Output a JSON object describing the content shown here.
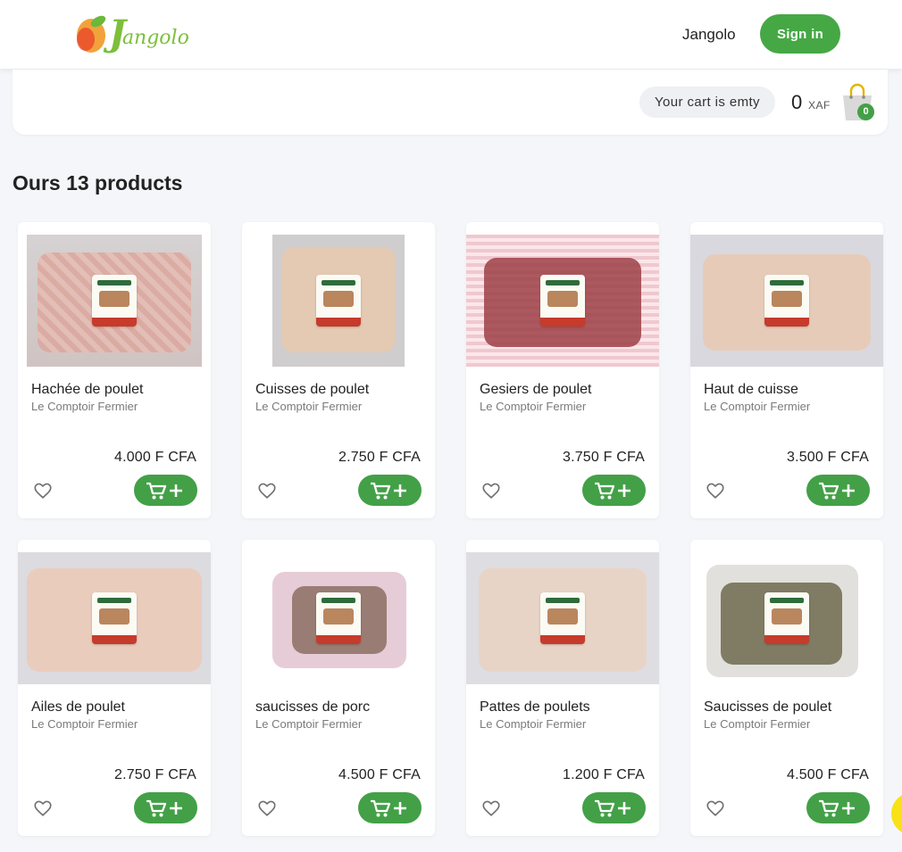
{
  "header": {
    "logo_text_initial": "J",
    "logo_text_rest": "angolo",
    "nav_link": "Jangolo",
    "signin_label": "Sign in"
  },
  "cart": {
    "status": "Your cart is emty",
    "total": "0",
    "currency": "XAF",
    "count": "0"
  },
  "section_title": "Ours 13 products",
  "colors": {
    "accent_green": "#43a047",
    "brand_green": "#7cbf3a",
    "logo_orange": "#f2a23a"
  },
  "products": [
    {
      "name": "Hachée de poulet",
      "vendor": "Le Comptoir Fermier",
      "price": "4.000 F CFA"
    },
    {
      "name": "Cuisses de poulet",
      "vendor": "Le Comptoir Fermier",
      "price": "2.750 F CFA"
    },
    {
      "name": "Gesiers de poulet",
      "vendor": "Le Comptoir Fermier",
      "price": "3.750 F CFA"
    },
    {
      "name": "Haut de cuisse",
      "vendor": "Le Comptoir Fermier",
      "price": "3.500 F CFA"
    },
    {
      "name": "Ailes de poulet",
      "vendor": "Le Comptoir Fermier",
      "price": "2.750 F CFA"
    },
    {
      "name": "saucisses de porc",
      "vendor": "Le Comptoir Fermier",
      "price": "4.500 F CFA"
    },
    {
      "name": "Pattes de poulets",
      "vendor": "Le Comptoir Fermier",
      "price": "1.200 F CFA"
    },
    {
      "name": "Saucisses de poulet",
      "vendor": "Le Comptoir Fermier",
      "price": "4.500 F CFA"
    }
  ],
  "icons": {
    "favorite": "heart-outline-icon",
    "add_to_cart": "cart-plus-icon",
    "cart": "shopping-bag-icon"
  }
}
